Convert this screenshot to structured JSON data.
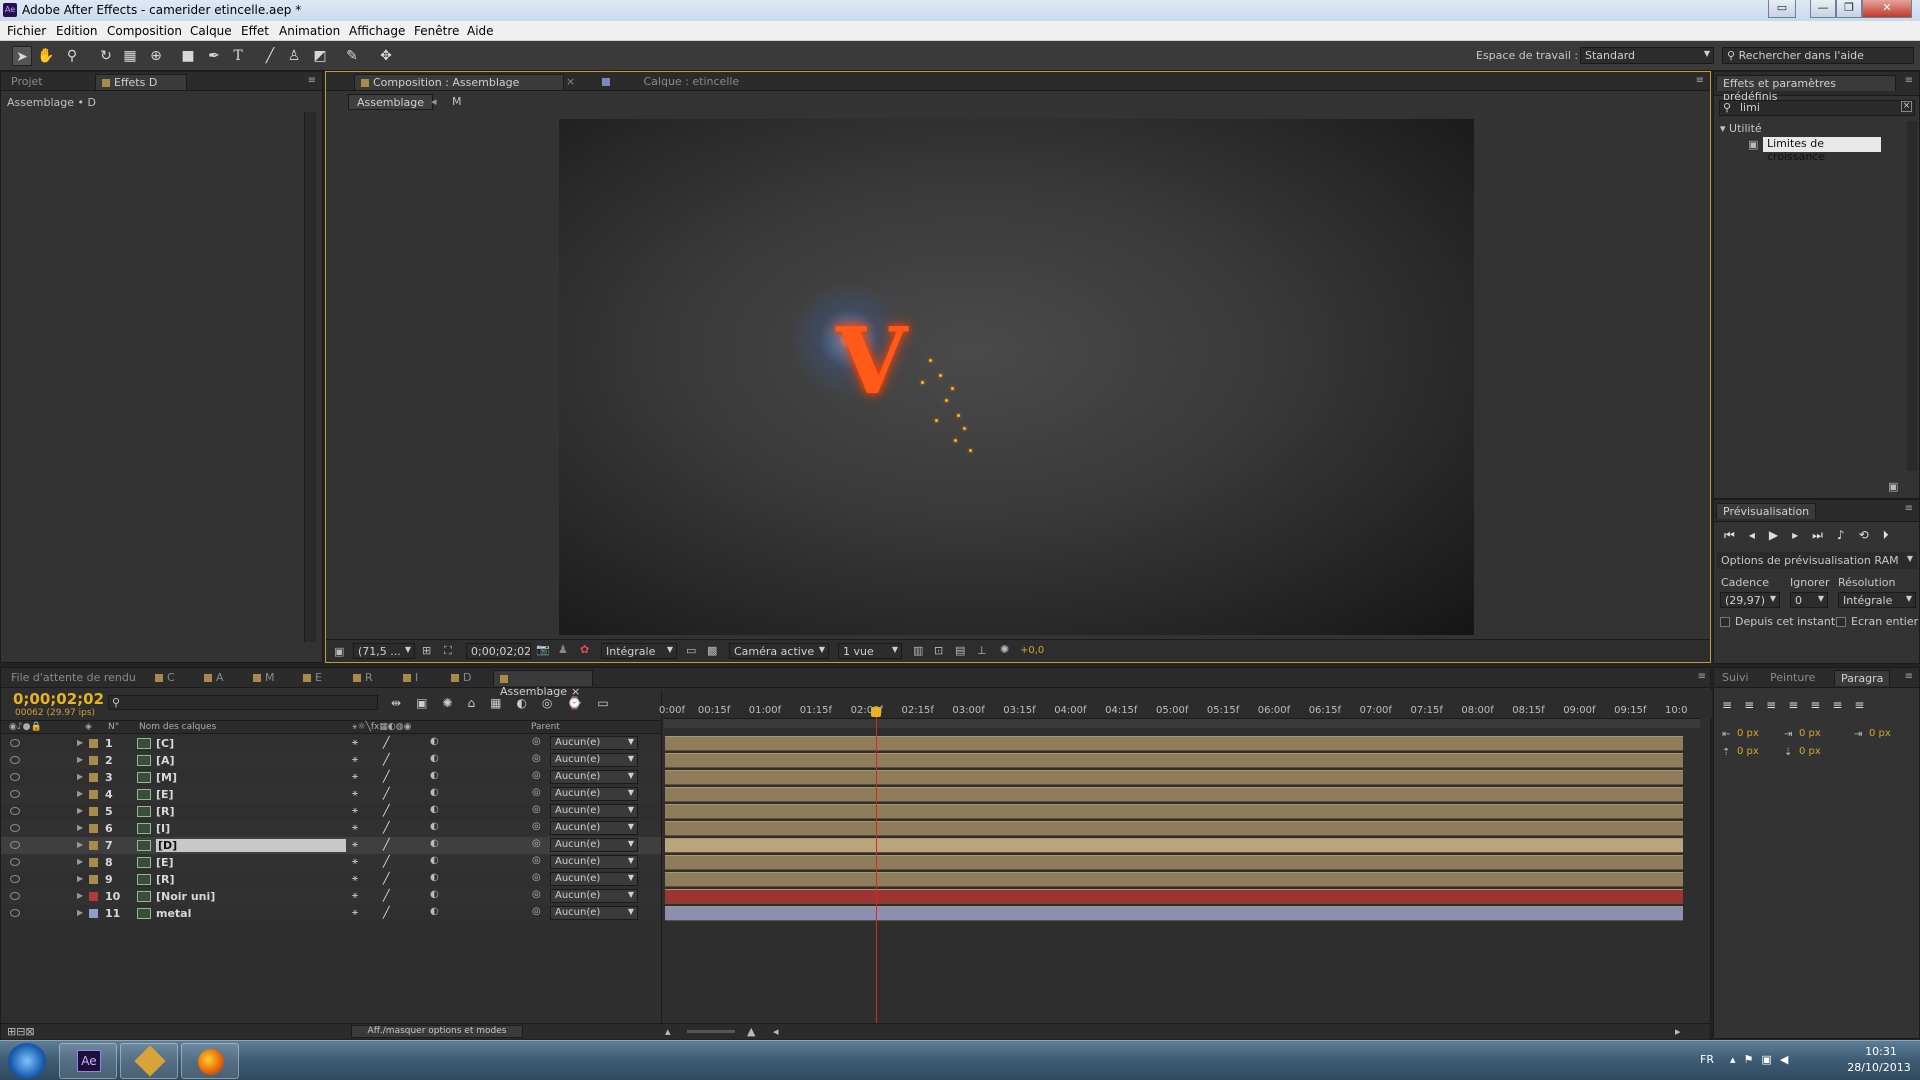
{
  "window": {
    "title": "Adobe After Effects - camerider etincelle.aep *",
    "app_icon": "Ae",
    "controls": [
      "▭",
      "—",
      "❐",
      "✕"
    ]
  },
  "menubar": [
    "Fichier",
    "Edition",
    "Composition",
    "Calque",
    "Effet",
    "Animation",
    "Affichage",
    "Fenêtre",
    "Aide"
  ],
  "toolbar": {
    "workspace_label": "Espace de travail :",
    "workspace_value": "Standard",
    "help_search_placeholder": "Rechercher dans l'aide"
  },
  "project_panel": {
    "tab_project": "Projet",
    "tab_effects": "Effets D",
    "breadcrumb": "Assemblage • D"
  },
  "comp_panel": {
    "tab_composition": "Composition : Assemblage",
    "tab_layer": "Calque : etincelle",
    "crumb_1": "Assemblage",
    "crumb_2": "M",
    "zoom": "(71,5 ...",
    "timecode": "0;00;02;02",
    "resolution": "Intégrale",
    "camera": "Caméra active",
    "views": "1 vue",
    "exposure": "+0,0"
  },
  "effects_panel": {
    "title": "Effets et paramètres prédéfinis",
    "search_value": "limi",
    "category": "Utilité",
    "item": "Limites de croissance"
  },
  "preview_panel": {
    "title": "Prévisualisation",
    "ram_options": "Options de prévisualisation RAM",
    "cadence_label": "Cadence",
    "ignore_label": "Ignorer",
    "resolution_label": "Résolution",
    "cadence_value": "(29,97)",
    "ignore_value": "0",
    "resolution_value": "Intégrale",
    "from_current": "Depuis cet instant",
    "fullscreen": "Ecran entier"
  },
  "bottom_tabs": {
    "render_queue": "File d'attente de rendu",
    "comps": [
      "C",
      "A",
      "M",
      "E",
      "R",
      "I",
      "D",
      "Assemblage"
    ],
    "right_tabs": [
      "Suivi",
      "Peinture",
      "Paragra"
    ]
  },
  "timeline": {
    "current_time": "0;00;02;02",
    "frame_info": "00062 (29.97 ips)",
    "col_num": "N°",
    "col_name": "Nom des calques",
    "col_parent": "Parent",
    "ruler": [
      "0:00f",
      "00:15f",
      "01:00f",
      "01:15f",
      "02:00f",
      "02:15f",
      "03:00f",
      "03:15f",
      "04:00f",
      "04:15f",
      "05:00f",
      "05:15f",
      "06:00f",
      "06:15f",
      "07:00f",
      "07:15f",
      "08:00f",
      "08:15f",
      "09:00f",
      "09:15f",
      "10:0"
    ],
    "playhead_seconds": 2.07,
    "duration_seconds": 10,
    "toggle_label": "Aff./masquer options et modes",
    "layers": [
      {
        "num": "1",
        "name": "[C]",
        "parent": "Aucun(e)",
        "color": "#a88a4b",
        "type": "comp",
        "bar": "#8f7c5a"
      },
      {
        "num": "2",
        "name": "[A]",
        "parent": "Aucun(e)",
        "color": "#a88a4b",
        "type": "comp",
        "bar": "#8f7c5a"
      },
      {
        "num": "3",
        "name": "[M]",
        "parent": "Aucun(e)",
        "color": "#a88a4b",
        "type": "comp",
        "bar": "#8f7c5a"
      },
      {
        "num": "4",
        "name": "[E]",
        "parent": "Aucun(e)",
        "color": "#a88a4b",
        "type": "comp",
        "bar": "#8f7c5a"
      },
      {
        "num": "5",
        "name": "[R]",
        "parent": "Aucun(e)",
        "color": "#a88a4b",
        "type": "comp",
        "bar": "#8f7c5a"
      },
      {
        "num": "6",
        "name": "[I]",
        "parent": "Aucun(e)",
        "color": "#a88a4b",
        "type": "comp",
        "bar": "#8f7c5a"
      },
      {
        "num": "7",
        "name": "[D]",
        "parent": "Aucun(e)",
        "color": "#a88a4b",
        "type": "comp",
        "bar": "#b9a57c",
        "selected": true
      },
      {
        "num": "8",
        "name": "[E]",
        "parent": "Aucun(e)",
        "color": "#a88a4b",
        "type": "comp",
        "bar": "#8f7c5a"
      },
      {
        "num": "9",
        "name": "[R]",
        "parent": "Aucun(e)",
        "color": "#a88a4b",
        "type": "comp",
        "bar": "#8f7c5a"
      },
      {
        "num": "10",
        "name": "[Noir uni]",
        "parent": "Aucun(e)",
        "color": "#b33a3a",
        "type": "solid",
        "bar": "#9c3434"
      },
      {
        "num": "11",
        "name": "metal",
        "parent": "Aucun(e)",
        "color": "#8aa0c8",
        "type": "image",
        "bar": "#8d8fb0"
      }
    ]
  },
  "paragraph_panel": {
    "fields": [
      "0 px",
      "0 px",
      "0 px",
      "0 px",
      "0 px"
    ]
  },
  "taskbar": {
    "lang": "FR",
    "time": "10:31",
    "date": "28/10/2013"
  }
}
